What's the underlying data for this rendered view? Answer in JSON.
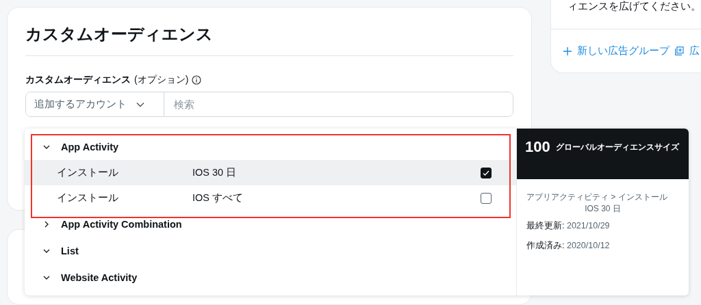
{
  "main_card": {
    "title": "カスタムオーディエンス",
    "field_label": "カスタムオーディエンス",
    "field_label_note": "(オプション)",
    "account_select": "追加するアカウント",
    "search": {
      "placeholder": "検索"
    }
  },
  "side_card": {
    "text": "ィエンスを広げてください。",
    "link": "新しい広告グループ",
    "link_2": "広"
  },
  "dropdown": {
    "groups": [
      {
        "label": "App Activity",
        "expanded": true,
        "children": [
          {
            "label": "インストール",
            "name": "IOS 30 日",
            "checked": true,
            "selected": true
          },
          {
            "label": "インストール",
            "name": "IOS すべて",
            "checked": false,
            "selected": false
          }
        ]
      },
      {
        "label": "App Activity Combination",
        "expanded": false
      },
      {
        "label": "List",
        "expanded": true
      },
      {
        "label": "Website Activity",
        "expanded": true
      }
    ]
  },
  "details": {
    "count": "100",
    "count_label": "グローバルオーディエンスサイズ",
    "path": "アプリアクティビティ > インストール",
    "path_2": "IOS 30 日",
    "facts": [
      {
        "label": "最終更新:",
        "value": "2021/10/29"
      },
      {
        "label": "作成済み:",
        "value": "2020/10/12"
      }
    ]
  }
}
